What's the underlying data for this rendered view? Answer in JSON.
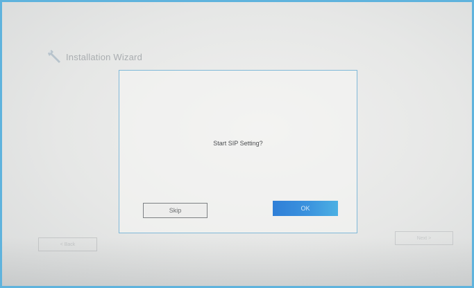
{
  "wizard": {
    "title": "Installation Wizard",
    "icon": "wrench-icon"
  },
  "dialog": {
    "message": "Start SIP Setting?",
    "skip_label": "Skip",
    "ok_label": "OK"
  },
  "navigation": {
    "back_label": "< Back",
    "next_label": "Next >"
  },
  "colors": {
    "frame_border": "#5fb3dd",
    "dialog_border": "#7fb8d8",
    "ok_button": "#2f7fd7"
  }
}
